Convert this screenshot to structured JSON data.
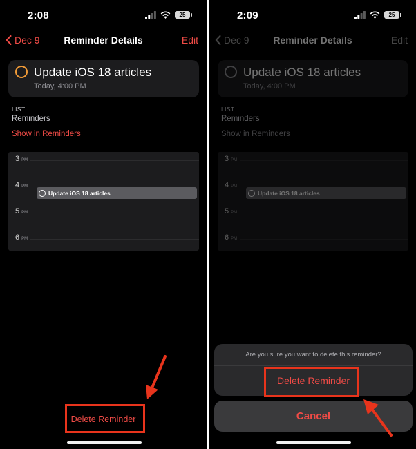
{
  "left": {
    "status": {
      "time": "2:08",
      "battery": "25"
    },
    "nav": {
      "back_label": "Dec 9",
      "title": "Reminder Details",
      "edit_label": "Edit"
    },
    "reminder": {
      "title": "Update iOS 18 articles",
      "subtitle": "Today, 4:00 PM"
    },
    "list": {
      "label": "LIST",
      "value": "Reminders",
      "show_link": "Show in Reminders"
    },
    "calendar": {
      "hours": [
        {
          "hour": "3",
          "suffix": "PM"
        },
        {
          "hour": "4",
          "suffix": "PM"
        },
        {
          "hour": "5",
          "suffix": "PM"
        },
        {
          "hour": "6",
          "suffix": "PM"
        }
      ],
      "event_title": "Update iOS 18 articles"
    },
    "delete_label": "Delete Reminder"
  },
  "right": {
    "status": {
      "time": "2:09",
      "battery": "25"
    },
    "nav": {
      "back_label": "Dec 9",
      "title": "Reminder Details",
      "edit_label": "Edit"
    },
    "reminder": {
      "title": "Update iOS 18 articles",
      "subtitle": "Today, 4:00 PM"
    },
    "list": {
      "label": "LIST",
      "value": "Reminders",
      "show_link": "Show in Reminders"
    },
    "calendar": {
      "hours": [
        {
          "hour": "3",
          "suffix": "PM"
        },
        {
          "hour": "4",
          "suffix": "PM"
        },
        {
          "hour": "5",
          "suffix": "PM"
        },
        {
          "hour": "6",
          "suffix": "PM"
        }
      ],
      "event_title": "Update iOS 18 articles"
    },
    "sheet": {
      "message": "Are you sure you want to delete this reminder?",
      "delete_label": "Delete Reminder",
      "cancel_label": "Cancel"
    }
  },
  "colors": {
    "accent_red": "#ef4b46",
    "reminder_circle": "#f09a37",
    "annotation_red": "#e8341c"
  },
  "icons": [
    "chevron-left-icon",
    "cellular-signal-icon",
    "wifi-icon",
    "battery-icon",
    "reminder-circle-icon",
    "annotation-arrow-icon"
  ]
}
